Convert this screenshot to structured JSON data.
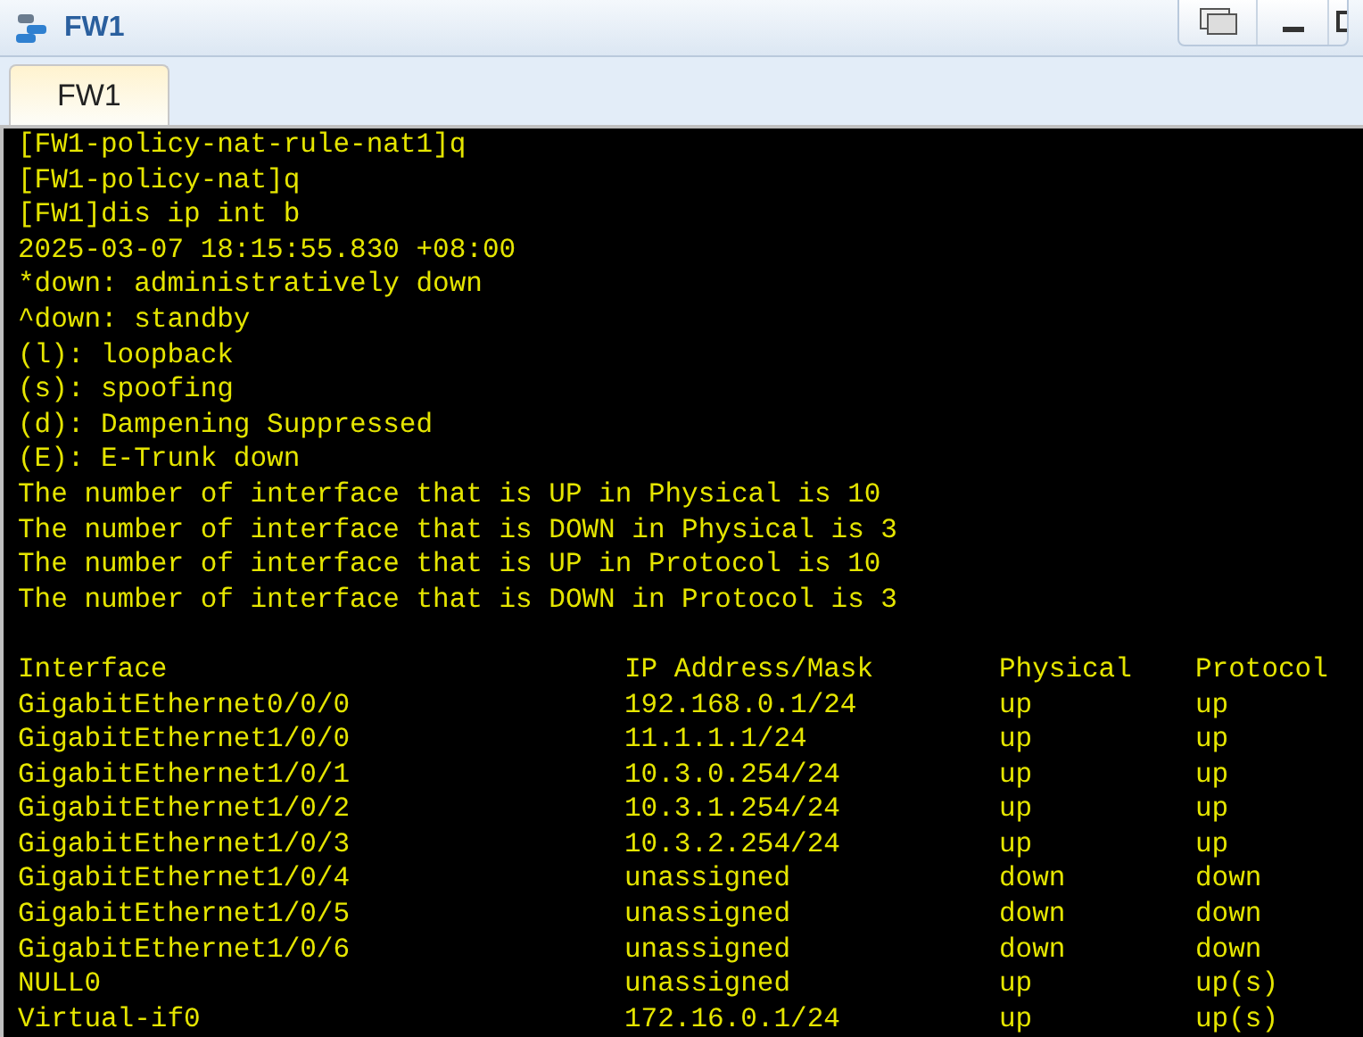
{
  "window": {
    "title": "FW1"
  },
  "tabs": [
    {
      "label": "FW1",
      "selected": true
    }
  ],
  "terminal": {
    "lines": [
      "[FW1-policy-nat-rule-nat1]q",
      "[FW1-policy-nat]q",
      "[FW1]dis ip int b",
      "2025-03-07 18:15:55.830 +08:00",
      "*down: administratively down",
      "^down: standby",
      "(l): loopback",
      "(s): spoofing",
      "(d): Dampening Suppressed",
      "(E): E-Trunk down",
      "The number of interface that is UP in Physical is 10",
      "The number of interface that is DOWN in Physical is 3",
      "The number of interface that is UP in Protocol is 10",
      "The number of interface that is DOWN in Protocol is 3"
    ],
    "table": {
      "columns": [
        "Interface",
        "IP Address/Mask",
        "Physical",
        "Protocol"
      ],
      "rows": [
        [
          "GigabitEthernet0/0/0",
          "192.168.0.1/24",
          "up",
          "up"
        ],
        [
          "GigabitEthernet1/0/0",
          "11.1.1.1/24",
          "up",
          "up"
        ],
        [
          "GigabitEthernet1/0/1",
          "10.3.0.254/24",
          "up",
          "up"
        ],
        [
          "GigabitEthernet1/0/2",
          "10.3.1.254/24",
          "up",
          "up"
        ],
        [
          "GigabitEthernet1/0/3",
          "10.3.2.254/24",
          "up",
          "up"
        ],
        [
          "GigabitEthernet1/0/4",
          "unassigned",
          "down",
          "down"
        ],
        [
          "GigabitEthernet1/0/5",
          "unassigned",
          "down",
          "down"
        ],
        [
          "GigabitEthernet1/0/6",
          "unassigned",
          "down",
          "down"
        ],
        [
          "NULL0",
          "unassigned",
          "up",
          "up(s)"
        ],
        [
          "Virtual-if0",
          "172.16.0.1/24",
          "up",
          "up(s)"
        ]
      ]
    }
  }
}
